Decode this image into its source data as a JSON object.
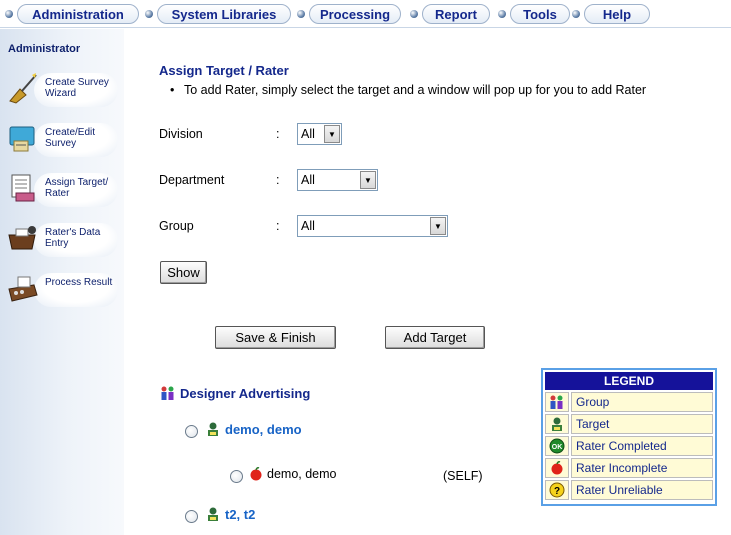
{
  "nav": {
    "tabs": [
      "Administration",
      "System Libraries",
      "Processing",
      "Report",
      "Tools",
      "Help"
    ]
  },
  "sidebar": {
    "title": "Administrator",
    "items": [
      {
        "label": "Create Survey Wizard",
        "icon": "wizard-icon"
      },
      {
        "label": "Create/Edit Survey",
        "icon": "edit-survey-icon"
      },
      {
        "label": "Assign Target/ Rater",
        "icon": "assign-target-icon"
      },
      {
        "label": "Rater's Data Entry",
        "icon": "data-entry-icon"
      },
      {
        "label": "Process Result",
        "icon": "process-result-icon"
      }
    ]
  },
  "form": {
    "title": "Assign Target / Rater",
    "instruction": "To add Rater, simply select the target and a window will pop up for you to add Rater",
    "fields": [
      {
        "label": "Division",
        "colon": ":",
        "value": "All"
      },
      {
        "label": "Department",
        "colon": ":",
        "value": "All"
      },
      {
        "label": "Group",
        "colon": ":",
        "value": "All"
      }
    ],
    "show_button": "Show",
    "save_button": "Save & Finish",
    "add_target_button": "Add Target"
  },
  "tree": {
    "group_name": "Designer Advertising",
    "targets": [
      {
        "name": "demo, demo",
        "raters": [
          {
            "name": "demo, demo",
            "relation": "(SELF)",
            "status": "Rater Incomplete"
          }
        ]
      },
      {
        "name": "t2, t2",
        "raters": []
      }
    ]
  },
  "legend": {
    "title": "LEGEND",
    "items": [
      {
        "label": "Group",
        "icon": "group-icon"
      },
      {
        "label": "Target",
        "icon": "target-icon"
      },
      {
        "label": "Rater Completed",
        "icon": "ok-icon"
      },
      {
        "label": "Rater Incomplete",
        "icon": "apple-icon"
      },
      {
        "label": "Rater Unreliable",
        "icon": "question-icon"
      }
    ]
  },
  "colors": {
    "nav_text": "#14288c",
    "link_blue": "#1763c6",
    "legend_header": "#15129a",
    "legend_cell": "#fffbd6",
    "legend_border": "#5aa0e6"
  }
}
